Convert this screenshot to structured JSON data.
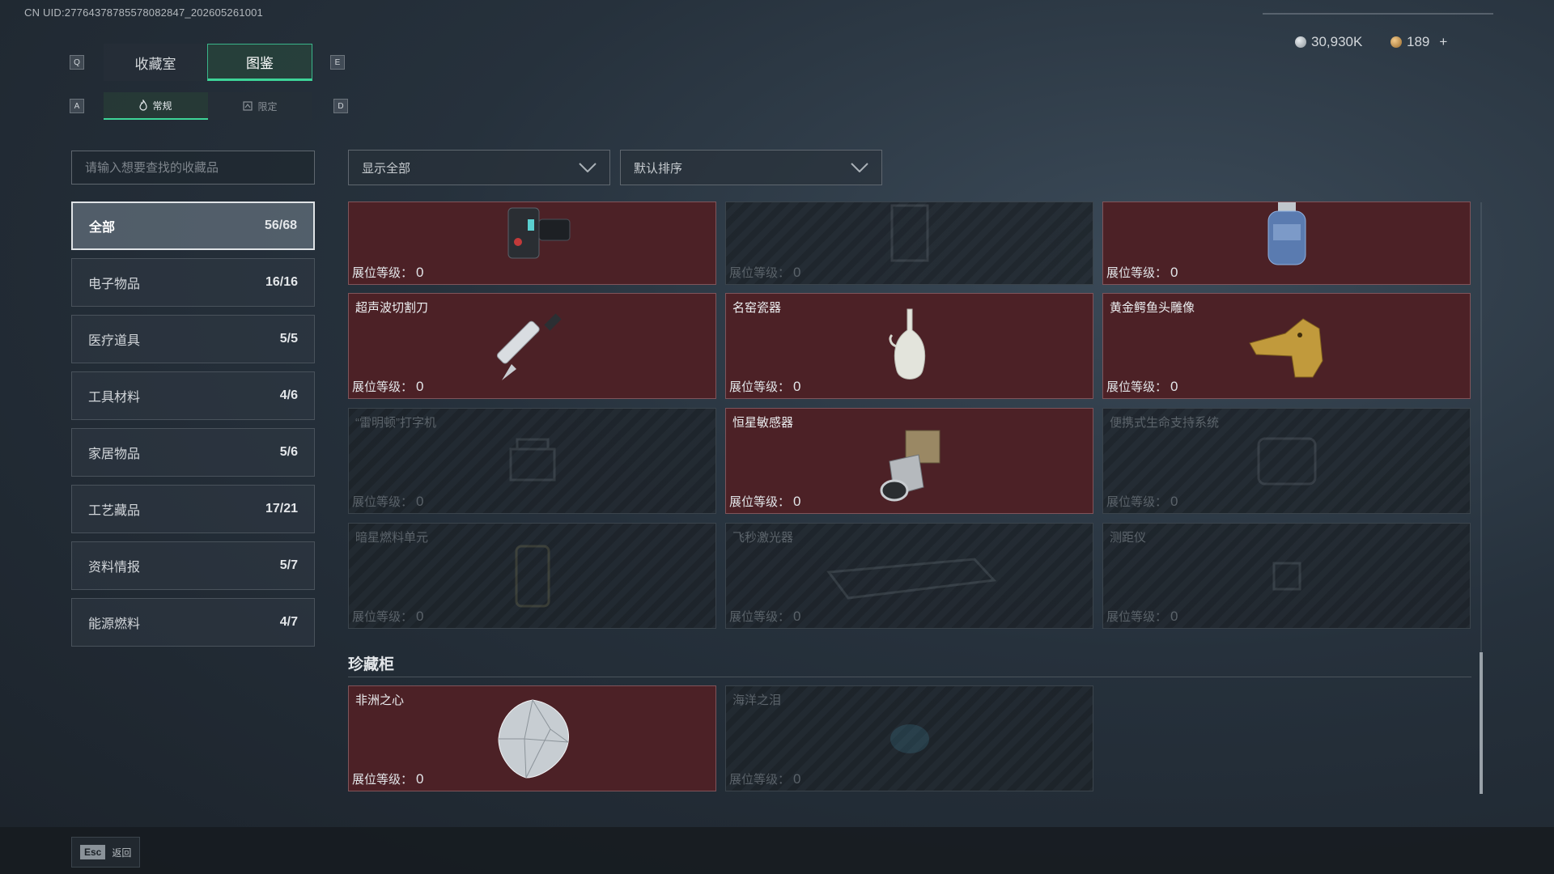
{
  "header": {
    "uid": "CN UID:27764378785578082847_202605261001",
    "key_q": "Q",
    "key_e": "E",
    "key_a": "A",
    "key_d": "D"
  },
  "tabs": [
    {
      "label": "收藏室",
      "active": false
    },
    {
      "label": "图鉴",
      "active": true
    }
  ],
  "subtabs": [
    {
      "label": "常规",
      "icon": "flame-icon",
      "active": true
    },
    {
      "label": "限定",
      "icon": "limited-icon",
      "active": false
    }
  ],
  "wallet": {
    "silver": "30,930K",
    "gold": "189",
    "add": "+",
    "silver_color": "#b8c0c6",
    "gold_color": "#c99a52"
  },
  "search": {
    "placeholder": "请输入想要查找的收藏品"
  },
  "categories": [
    {
      "name": "全部",
      "count": "56/68",
      "active": true
    },
    {
      "name": "电子物品",
      "count": "16/16"
    },
    {
      "name": "医疗道具",
      "count": "5/5"
    },
    {
      "name": "工具材料",
      "count": "4/6"
    },
    {
      "name": "家居物品",
      "count": "5/6"
    },
    {
      "name": "工艺藏品",
      "count": "17/21"
    },
    {
      "name": "资料情报",
      "count": "5/7"
    },
    {
      "name": "能源燃料",
      "count": "4/7"
    }
  ],
  "filters": {
    "show": "显示全部",
    "sort": "默认排序"
  },
  "level_label": "展位等级：",
  "items": [
    {
      "name": "",
      "level": "0",
      "owned": true,
      "icon": "wrist-device-icon"
    },
    {
      "name": "",
      "level": "0",
      "owned": false,
      "icon": "locked-item-icon"
    },
    {
      "name": "",
      "level": "0",
      "owned": true,
      "icon": "gas-canister-icon"
    },
    {
      "name": "超声波切割刀",
      "level": "0",
      "owned": true,
      "icon": "ultrasonic-knife-icon"
    },
    {
      "name": "名窑瓷器",
      "level": "0",
      "owned": true,
      "icon": "porcelain-vase-icon"
    },
    {
      "name": "黄金鳄鱼头雕像",
      "level": "0",
      "owned": true,
      "icon": "golden-crocodile-icon"
    },
    {
      "name": "“雷明顿”打字机",
      "level": "0",
      "owned": false,
      "icon": "typewriter-icon"
    },
    {
      "name": "恒星敏感器",
      "level": "0",
      "owned": true,
      "icon": "star-sensor-icon"
    },
    {
      "name": "便携式生命支持系统",
      "level": "0",
      "owned": false,
      "icon": "life-support-icon"
    },
    {
      "name": "暗星燃料单元",
      "level": "0",
      "owned": false,
      "icon": "fuel-cell-icon"
    },
    {
      "name": "飞秒激光器",
      "level": "0",
      "owned": false,
      "icon": "laser-icon"
    },
    {
      "name": "测距仪",
      "level": "0",
      "owned": false,
      "icon": "rangefinder-icon"
    }
  ],
  "vault": {
    "title": "珍藏柜",
    "items": [
      {
        "name": "非洲之心",
        "level": "0",
        "owned": true,
        "icon": "diamond-icon"
      },
      {
        "name": "海洋之泪",
        "level": "0",
        "owned": false,
        "icon": "gem-icon"
      }
    ]
  },
  "footer": {
    "esc": "Esc",
    "back": "返回"
  }
}
